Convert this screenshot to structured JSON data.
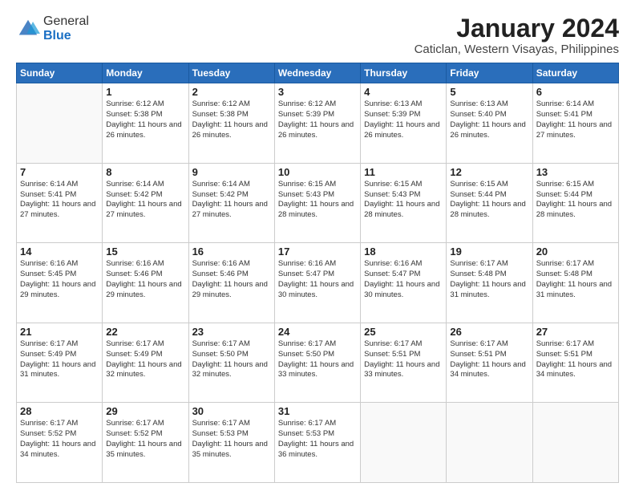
{
  "header": {
    "logo_general": "General",
    "logo_blue": "Blue",
    "month": "January 2024",
    "location": "Caticlan, Western Visayas, Philippines"
  },
  "days_of_week": [
    "Sunday",
    "Monday",
    "Tuesday",
    "Wednesday",
    "Thursday",
    "Friday",
    "Saturday"
  ],
  "weeks": [
    [
      {
        "day": "",
        "sunrise": "",
        "sunset": "",
        "daylight": ""
      },
      {
        "day": "1",
        "sunrise": "Sunrise: 6:12 AM",
        "sunset": "Sunset: 5:38 PM",
        "daylight": "Daylight: 11 hours and 26 minutes."
      },
      {
        "day": "2",
        "sunrise": "Sunrise: 6:12 AM",
        "sunset": "Sunset: 5:38 PM",
        "daylight": "Daylight: 11 hours and 26 minutes."
      },
      {
        "day": "3",
        "sunrise": "Sunrise: 6:12 AM",
        "sunset": "Sunset: 5:39 PM",
        "daylight": "Daylight: 11 hours and 26 minutes."
      },
      {
        "day": "4",
        "sunrise": "Sunrise: 6:13 AM",
        "sunset": "Sunset: 5:39 PM",
        "daylight": "Daylight: 11 hours and 26 minutes."
      },
      {
        "day": "5",
        "sunrise": "Sunrise: 6:13 AM",
        "sunset": "Sunset: 5:40 PM",
        "daylight": "Daylight: 11 hours and 26 minutes."
      },
      {
        "day": "6",
        "sunrise": "Sunrise: 6:14 AM",
        "sunset": "Sunset: 5:41 PM",
        "daylight": "Daylight: 11 hours and 27 minutes."
      }
    ],
    [
      {
        "day": "7",
        "sunrise": "Sunrise: 6:14 AM",
        "sunset": "Sunset: 5:41 PM",
        "daylight": "Daylight: 11 hours and 27 minutes."
      },
      {
        "day": "8",
        "sunrise": "Sunrise: 6:14 AM",
        "sunset": "Sunset: 5:42 PM",
        "daylight": "Daylight: 11 hours and 27 minutes."
      },
      {
        "day": "9",
        "sunrise": "Sunrise: 6:14 AM",
        "sunset": "Sunset: 5:42 PM",
        "daylight": "Daylight: 11 hours and 27 minutes."
      },
      {
        "day": "10",
        "sunrise": "Sunrise: 6:15 AM",
        "sunset": "Sunset: 5:43 PM",
        "daylight": "Daylight: 11 hours and 28 minutes."
      },
      {
        "day": "11",
        "sunrise": "Sunrise: 6:15 AM",
        "sunset": "Sunset: 5:43 PM",
        "daylight": "Daylight: 11 hours and 28 minutes."
      },
      {
        "day": "12",
        "sunrise": "Sunrise: 6:15 AM",
        "sunset": "Sunset: 5:44 PM",
        "daylight": "Daylight: 11 hours and 28 minutes."
      },
      {
        "day": "13",
        "sunrise": "Sunrise: 6:15 AM",
        "sunset": "Sunset: 5:44 PM",
        "daylight": "Daylight: 11 hours and 28 minutes."
      }
    ],
    [
      {
        "day": "14",
        "sunrise": "Sunrise: 6:16 AM",
        "sunset": "Sunset: 5:45 PM",
        "daylight": "Daylight: 11 hours and 29 minutes."
      },
      {
        "day": "15",
        "sunrise": "Sunrise: 6:16 AM",
        "sunset": "Sunset: 5:46 PM",
        "daylight": "Daylight: 11 hours and 29 minutes."
      },
      {
        "day": "16",
        "sunrise": "Sunrise: 6:16 AM",
        "sunset": "Sunset: 5:46 PM",
        "daylight": "Daylight: 11 hours and 29 minutes."
      },
      {
        "day": "17",
        "sunrise": "Sunrise: 6:16 AM",
        "sunset": "Sunset: 5:47 PM",
        "daylight": "Daylight: 11 hours and 30 minutes."
      },
      {
        "day": "18",
        "sunrise": "Sunrise: 6:16 AM",
        "sunset": "Sunset: 5:47 PM",
        "daylight": "Daylight: 11 hours and 30 minutes."
      },
      {
        "day": "19",
        "sunrise": "Sunrise: 6:17 AM",
        "sunset": "Sunset: 5:48 PM",
        "daylight": "Daylight: 11 hours and 31 minutes."
      },
      {
        "day": "20",
        "sunrise": "Sunrise: 6:17 AM",
        "sunset": "Sunset: 5:48 PM",
        "daylight": "Daylight: 11 hours and 31 minutes."
      }
    ],
    [
      {
        "day": "21",
        "sunrise": "Sunrise: 6:17 AM",
        "sunset": "Sunset: 5:49 PM",
        "daylight": "Daylight: 11 hours and 31 minutes."
      },
      {
        "day": "22",
        "sunrise": "Sunrise: 6:17 AM",
        "sunset": "Sunset: 5:49 PM",
        "daylight": "Daylight: 11 hours and 32 minutes."
      },
      {
        "day": "23",
        "sunrise": "Sunrise: 6:17 AM",
        "sunset": "Sunset: 5:50 PM",
        "daylight": "Daylight: 11 hours and 32 minutes."
      },
      {
        "day": "24",
        "sunrise": "Sunrise: 6:17 AM",
        "sunset": "Sunset: 5:50 PM",
        "daylight": "Daylight: 11 hours and 33 minutes."
      },
      {
        "day": "25",
        "sunrise": "Sunrise: 6:17 AM",
        "sunset": "Sunset: 5:51 PM",
        "daylight": "Daylight: 11 hours and 33 minutes."
      },
      {
        "day": "26",
        "sunrise": "Sunrise: 6:17 AM",
        "sunset": "Sunset: 5:51 PM",
        "daylight": "Daylight: 11 hours and 34 minutes."
      },
      {
        "day": "27",
        "sunrise": "Sunrise: 6:17 AM",
        "sunset": "Sunset: 5:51 PM",
        "daylight": "Daylight: 11 hours and 34 minutes."
      }
    ],
    [
      {
        "day": "28",
        "sunrise": "Sunrise: 6:17 AM",
        "sunset": "Sunset: 5:52 PM",
        "daylight": "Daylight: 11 hours and 34 minutes."
      },
      {
        "day": "29",
        "sunrise": "Sunrise: 6:17 AM",
        "sunset": "Sunset: 5:52 PM",
        "daylight": "Daylight: 11 hours and 35 minutes."
      },
      {
        "day": "30",
        "sunrise": "Sunrise: 6:17 AM",
        "sunset": "Sunset: 5:53 PM",
        "daylight": "Daylight: 11 hours and 35 minutes."
      },
      {
        "day": "31",
        "sunrise": "Sunrise: 6:17 AM",
        "sunset": "Sunset: 5:53 PM",
        "daylight": "Daylight: 11 hours and 36 minutes."
      },
      {
        "day": "",
        "sunrise": "",
        "sunset": "",
        "daylight": ""
      },
      {
        "day": "",
        "sunrise": "",
        "sunset": "",
        "daylight": ""
      },
      {
        "day": "",
        "sunrise": "",
        "sunset": "",
        "daylight": ""
      }
    ]
  ]
}
